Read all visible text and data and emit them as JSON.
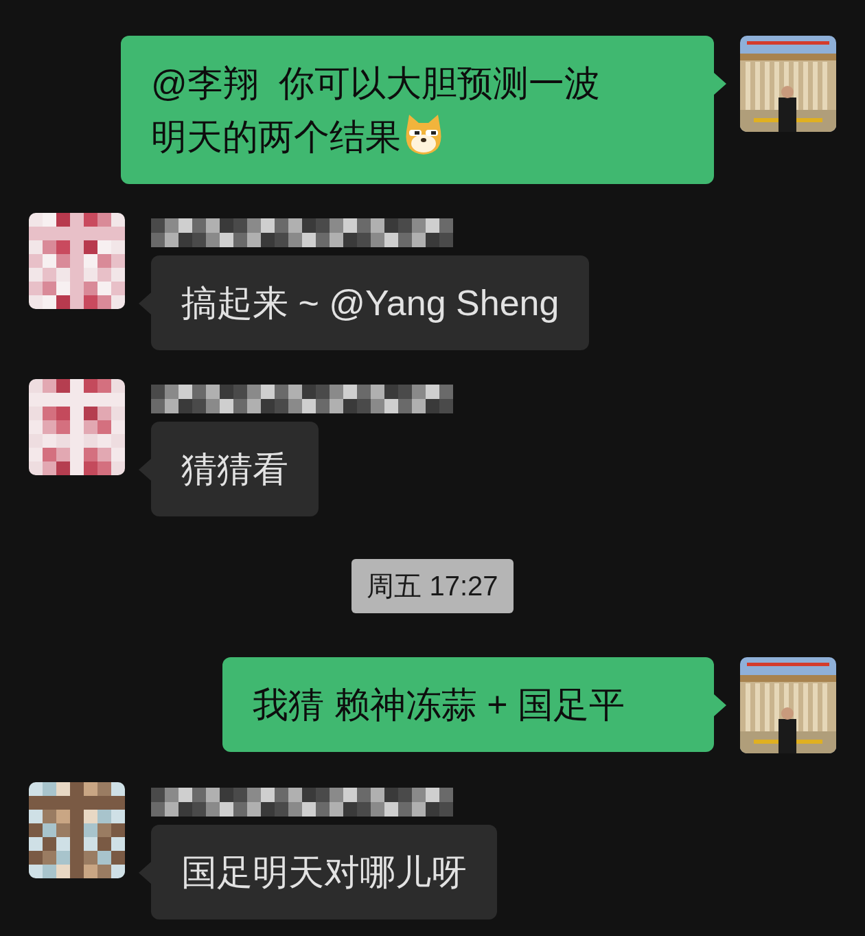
{
  "messages": [
    {
      "kind": "sent",
      "text": "@李翔  你可以大胆预测一波明天的两个结果",
      "emoji": true
    },
    {
      "kind": "received",
      "text": "搞起来 ~ @Yang Sheng"
    },
    {
      "kind": "received",
      "text": "猜猜看"
    },
    {
      "kind": "time",
      "text": "周五 17:27"
    },
    {
      "kind": "sent",
      "text": "我猜 赖神冻蒜 + 国足平"
    },
    {
      "kind": "received",
      "text": "国足明天对哪儿呀"
    }
  ]
}
